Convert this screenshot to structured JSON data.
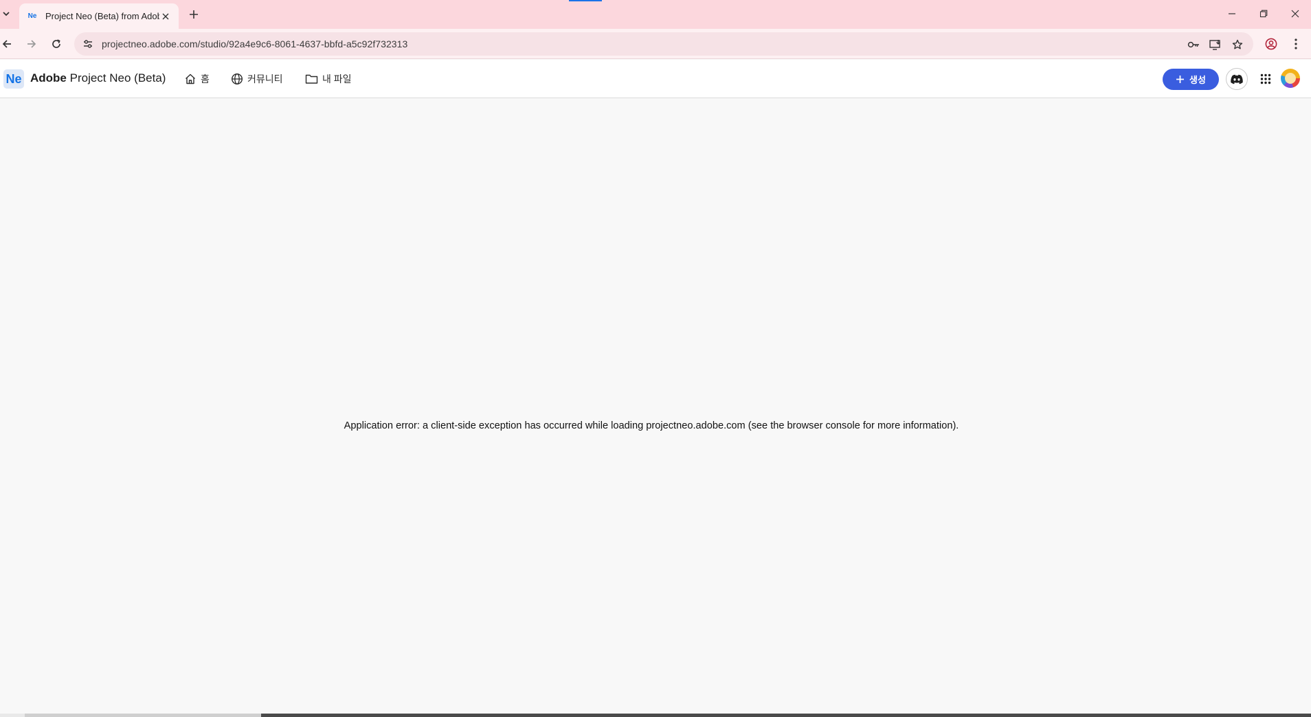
{
  "browser": {
    "tab": {
      "favicon_text": "Ne",
      "title": "Project Neo (Beta) from Adobe"
    },
    "address_bar": {
      "url": "projectneo.adobe.com/studio/92a4e9c6-8061-4637-bbfd-a5c92f732313"
    },
    "theme": {
      "tab_strip": "#fcd7dd",
      "toolbar": "#fdf0f2",
      "omnibox": "#f6e2e6"
    },
    "icons": [
      "tab-search-icon",
      "close-icon",
      "plus-icon",
      "minimize-icon",
      "restore-icon",
      "close-window-icon",
      "back-icon",
      "forward-icon",
      "reload-icon",
      "site-settings-icon",
      "password-key-icon",
      "install-app-icon",
      "bookmark-star-icon",
      "profile-icon",
      "menu-dots-icon"
    ]
  },
  "app": {
    "logo_text": "Ne",
    "brand_bold": "Adobe",
    "brand_rest": " Project Neo (Beta)",
    "nav": {
      "home": "홈",
      "community": "커뮤니티",
      "my_files": "내 파일"
    },
    "create_label": "생성",
    "accent_color": "#3a5ddf"
  },
  "content": {
    "error_message": "Application error: a client-side exception has occurred while loading projectneo.adobe.com (see the browser console for more information)."
  }
}
